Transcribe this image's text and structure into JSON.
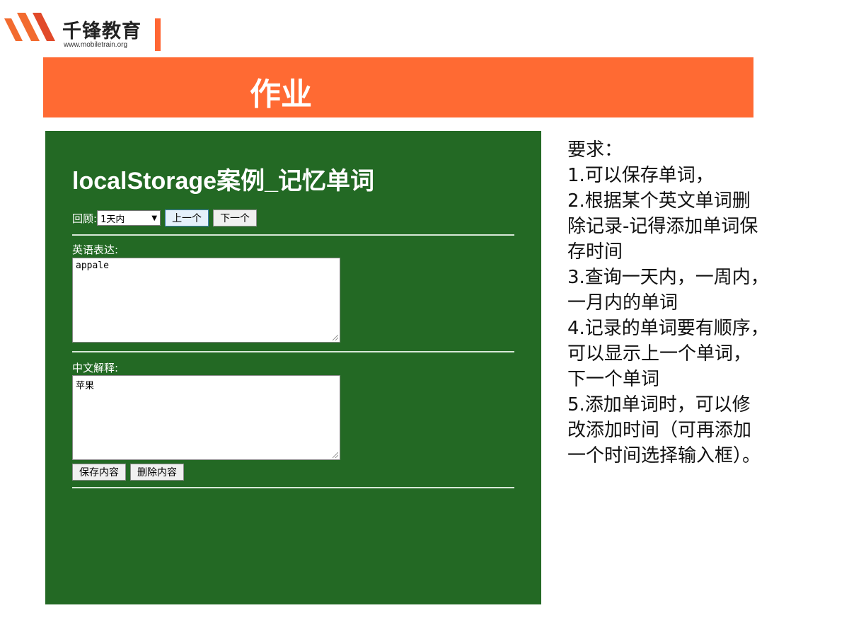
{
  "logo": {
    "name": "千锋教育",
    "url": "www.mobiletrain.org"
  },
  "header": {
    "title": "作业",
    "color": "#ff6a33"
  },
  "demo": {
    "background": "#236924",
    "title": "localStorage案例_记忆单词",
    "review_label": "回顾:",
    "review_select_value": "1天内",
    "prev_button": "上一个",
    "next_button": "下一个",
    "english_label": "英语表达:",
    "english_value": "appale",
    "chinese_label": "中文解释:",
    "chinese_value": "苹果",
    "save_button": "保存内容",
    "delete_button": "删除内容"
  },
  "requirements": {
    "lines": [
      "要求：",
      "1.可以保存单词，",
      "2.根据某个英文单词删",
      "除记录-记得添加单词保",
      "存时间",
      "3.查询一天内，一周内，",
      "一月内的单词",
      "4.记录的单词要有顺序，",
      "可以显示上一个单词，",
      "下一个单词",
      "5.添加单词时，可以修",
      "改添加时间（可再添加",
      "一个时间选择输入框）。"
    ]
  }
}
